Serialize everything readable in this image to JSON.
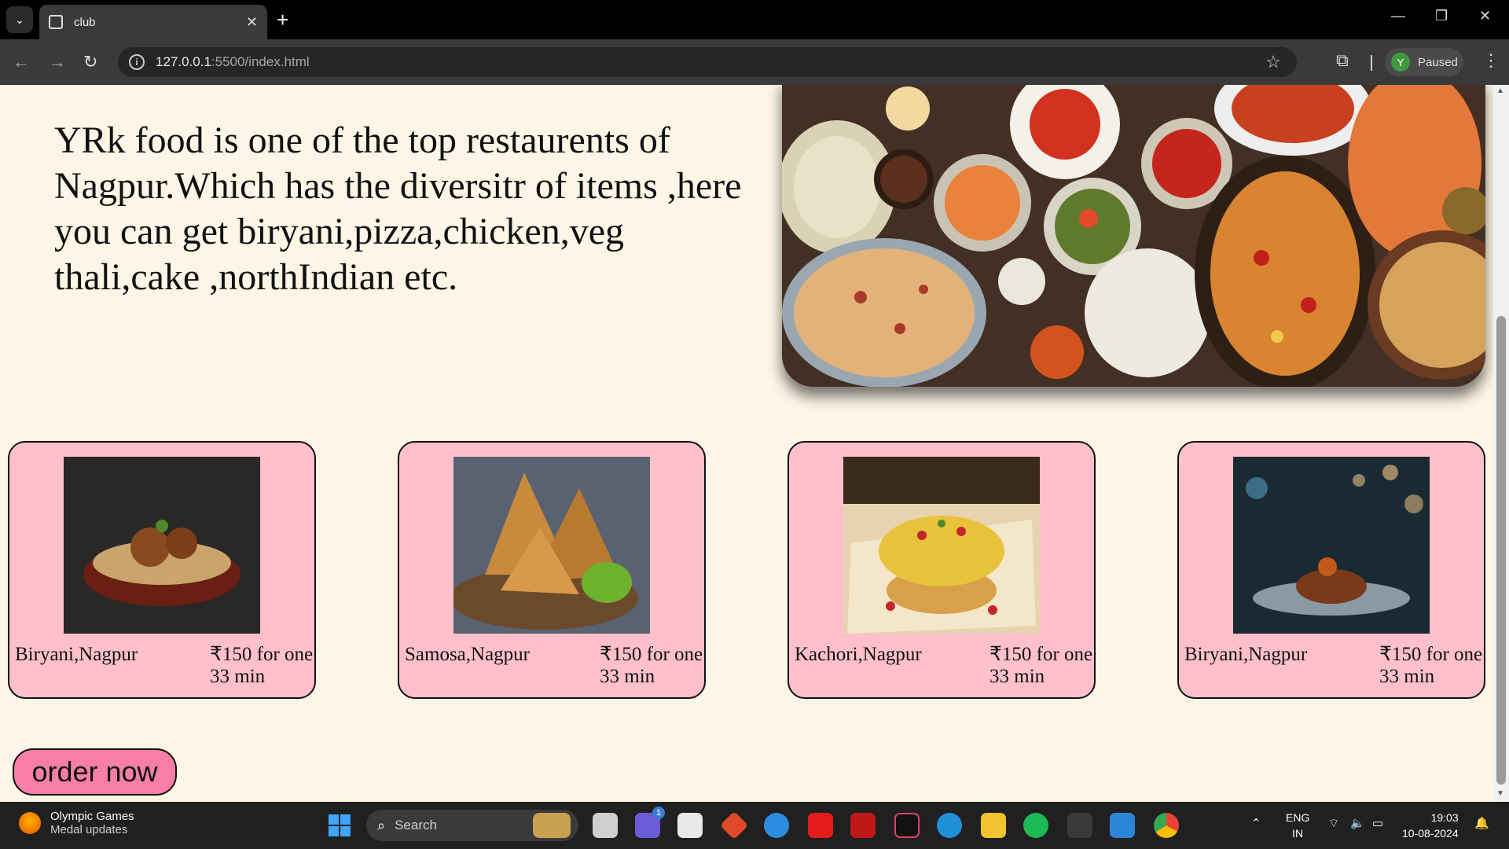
{
  "browser": {
    "tab_title": "club",
    "new_tab": "+",
    "url_host": "127.0.0.1",
    "url_rest": ":5500/index.html",
    "profile_initial": "Y",
    "profile_status": "Paused"
  },
  "page": {
    "intro_text": "YRk food is one of the top restaurents of Nagpur.Which has the diversitr of items ,here you can get biryani,pizza,chicken,veg thali,cake ,northIndian etc.",
    "cards": [
      {
        "name": "Biryani,Nagpur",
        "price": "₹150 for one",
        "time": "33 min"
      },
      {
        "name": "Samosa,Nagpur",
        "price": "₹150 for one",
        "time": "33 min"
      },
      {
        "name": "Kachori,Nagpur",
        "price": "₹150 for one",
        "time": "33 min"
      },
      {
        "name": "Biryani,Nagpur",
        "price": "₹150 for one",
        "time": "33 min"
      }
    ],
    "order_button": "order now"
  },
  "taskbar": {
    "weather_title": "Olympic Games",
    "weather_sub": "Medal updates",
    "search_placeholder": "Search",
    "lang_top": "ENG",
    "lang_bottom": "IN",
    "time": "19:03",
    "date": "10-08-2024",
    "teams_badge": "1"
  },
  "colors": {
    "page_bg": "#fdf5e6",
    "card_bg": "#ffc0cb",
    "order_bg": "#f77fa6"
  }
}
